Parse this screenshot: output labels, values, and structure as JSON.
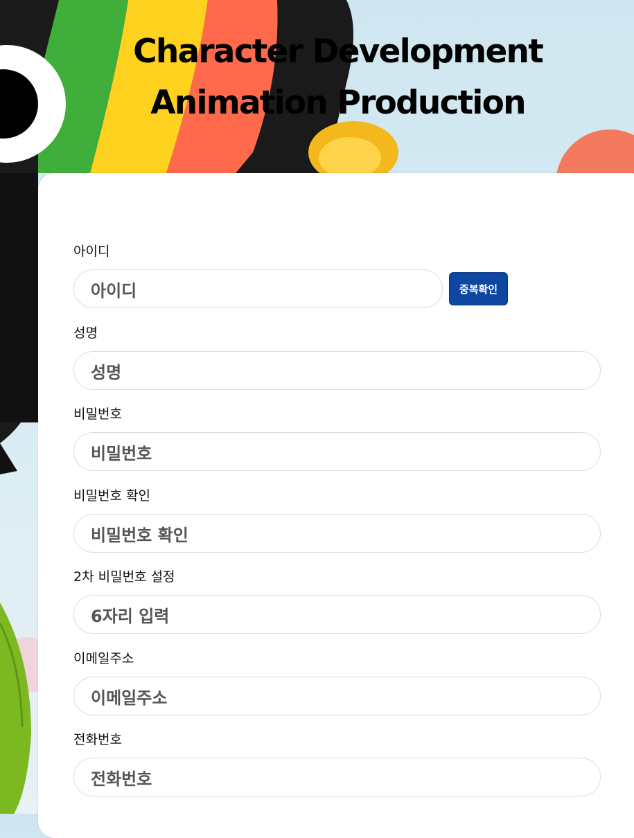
{
  "hero": {
    "title_line1": "Character Development",
    "title_line2": "Animation Production"
  },
  "form": {
    "username": {
      "label": "아이디",
      "placeholder": "아이디",
      "check_button": "중복확인"
    },
    "name": {
      "label": "성명",
      "placeholder": "성명"
    },
    "password": {
      "label": "비밀번호",
      "placeholder": "비밀번호"
    },
    "password_confirm": {
      "label": "비밀번호 확인",
      "placeholder": "비밀번호 확인"
    },
    "secondary_password": {
      "label": "2차 비밀번호 설정",
      "placeholder": "6자리 입력"
    },
    "email": {
      "label": "이메일주소",
      "placeholder": "이메일주소"
    },
    "phone": {
      "label": "전화번호",
      "placeholder": "전화번호"
    }
  },
  "colors": {
    "button_bg": "#0d47a1",
    "sky": "#cfe6f0",
    "character_black": "#111111",
    "stripe_green": "#3fae3a",
    "stripe_yellow": "#ffd21f",
    "stripe_red": "#ff6a4d"
  }
}
